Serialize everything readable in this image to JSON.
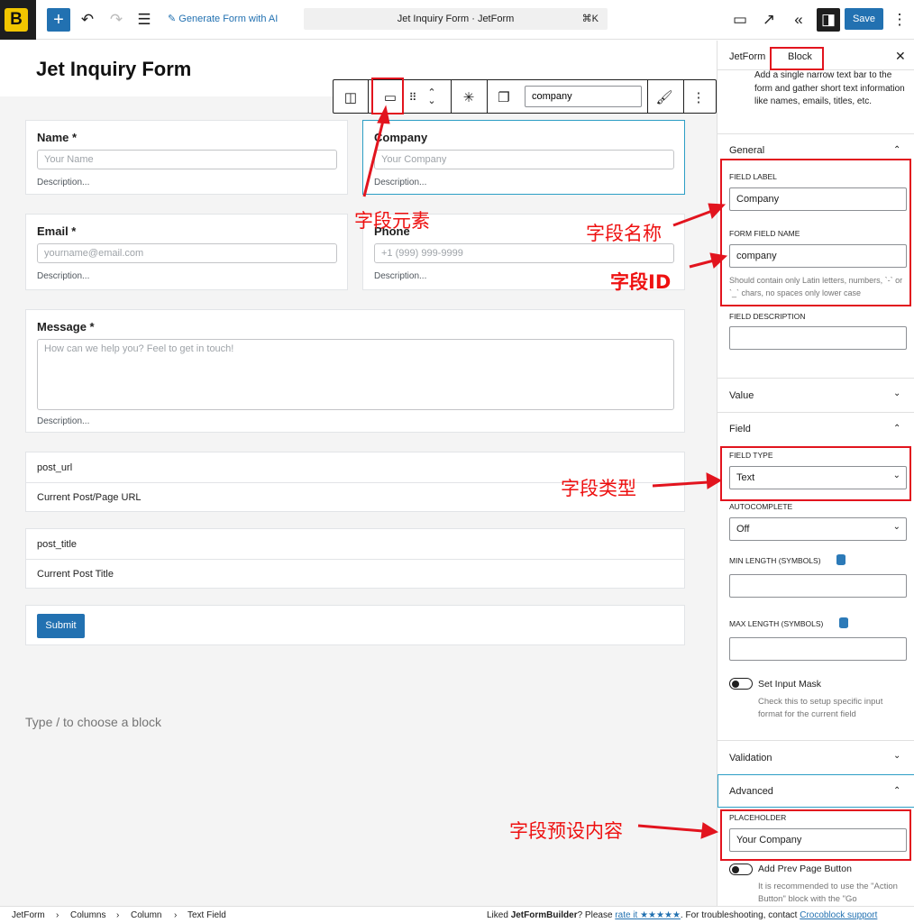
{
  "topbar": {
    "logo": "B",
    "generate_label": "Generate Form with AI",
    "doc_title": "Jet Inquiry Form · JetForm",
    "shortcut": "⌘K",
    "save_label": "Save"
  },
  "canvas": {
    "page_title": "Jet Inquiry Form",
    "toolbar_name_value": "company",
    "fields": [
      {
        "label": "Name *",
        "placeholder": "Your Name",
        "desc": "Description..."
      },
      {
        "label": "Company",
        "placeholder": "Your Company",
        "desc": "Description..."
      },
      {
        "label": "Email *",
        "placeholder": "yourname@email.com",
        "desc": "Description..."
      },
      {
        "label": "Phone",
        "placeholder": "+1 (999) 999-9999",
        "desc": "Description..."
      },
      {
        "label": "Message *",
        "placeholder": "How can we help you? Feel to get in touch!",
        "desc": "Description..."
      }
    ],
    "hidden1": {
      "name": "post_url",
      "value": "Current Post/Page URL"
    },
    "hidden2": {
      "name": "post_title",
      "value": "Current Post Title"
    },
    "submit_label": "Submit",
    "type_hint": "Type / to choose a block"
  },
  "annotations": {
    "field_element": "字段元素",
    "field_name": "字段名称",
    "field_id": "字段ID",
    "field_type": "字段类型",
    "field_placeholder": "字段预设内容"
  },
  "sidebar": {
    "tab_jetform": "JetForm",
    "tab_block": "Block",
    "block_desc": "Add a single narrow text bar to the form and gather short text information like names, emails, titles, etc.",
    "general": "General",
    "field_label_title": "FIELD LABEL",
    "field_label_value": "Company",
    "form_field_name_title": "FORM FIELD NAME",
    "form_field_name_value": "company",
    "name_help": "Should contain only Latin letters, numbers, `-` or `_` chars, no spaces only lower case",
    "field_desc_title": "FIELD DESCRIPTION",
    "value": "Value",
    "field": "Field",
    "field_type_title": "FIELD TYPE",
    "field_type_value": "Text",
    "autocomplete_title": "AUTOCOMPLETE",
    "autocomplete_value": "Off",
    "min_length_title": "MIN LENGTH (SYMBOLS)",
    "max_length_title": "MAX LENGTH (SYMBOLS)",
    "input_mask_label": "Set Input Mask",
    "input_mask_help": "Check this to setup specific input format for the current field",
    "validation": "Validation",
    "advanced": "Advanced",
    "placeholder_title": "PLACEHOLDER",
    "placeholder_value": "Your Company",
    "prev_page_label": "Add Prev Page Button",
    "prev_page_help": "It is recommended to use the \"Action Button\" block with the \"Go"
  },
  "statusbar": {
    "crumbs": [
      "JetForm",
      "Columns",
      "Column",
      "Text Field"
    ],
    "liked_a": "Liked ",
    "liked_b": "JetFormBuilder",
    "liked_c": "? Please ",
    "rate": "rate it ★★★★★",
    "liked_d": ". For troubleshooting, contact ",
    "support": "Crocoblock support"
  }
}
